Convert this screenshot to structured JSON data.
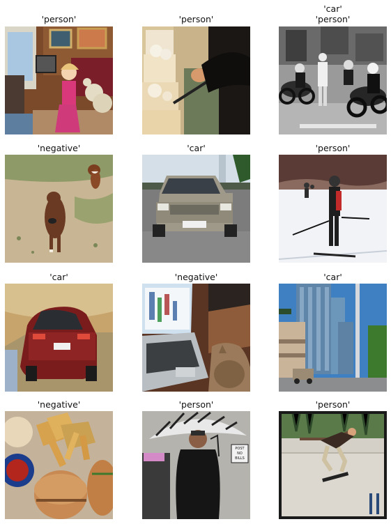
{
  "grid": {
    "cells": [
      {
        "labels": [
          "'person'"
        ]
      },
      {
        "labels": [
          "'person'"
        ]
      },
      {
        "labels": [
          "'car'",
          "'person'"
        ]
      },
      {
        "labels": [
          "'negative'"
        ]
      },
      {
        "labels": [
          "'car'"
        ]
      },
      {
        "labels": [
          "'person'"
        ]
      },
      {
        "labels": [
          "'car'"
        ]
      },
      {
        "labels": [
          "'negative'"
        ]
      },
      {
        "labels": [
          "'car'"
        ]
      },
      {
        "labels": [
          "'negative'"
        ]
      },
      {
        "labels": [
          "'person'"
        ]
      },
      {
        "labels": [
          "'person'"
        ]
      }
    ]
  },
  "scene_texts": {
    "post_sign": [
      "POST",
      "NO",
      "BILLS"
    ]
  }
}
